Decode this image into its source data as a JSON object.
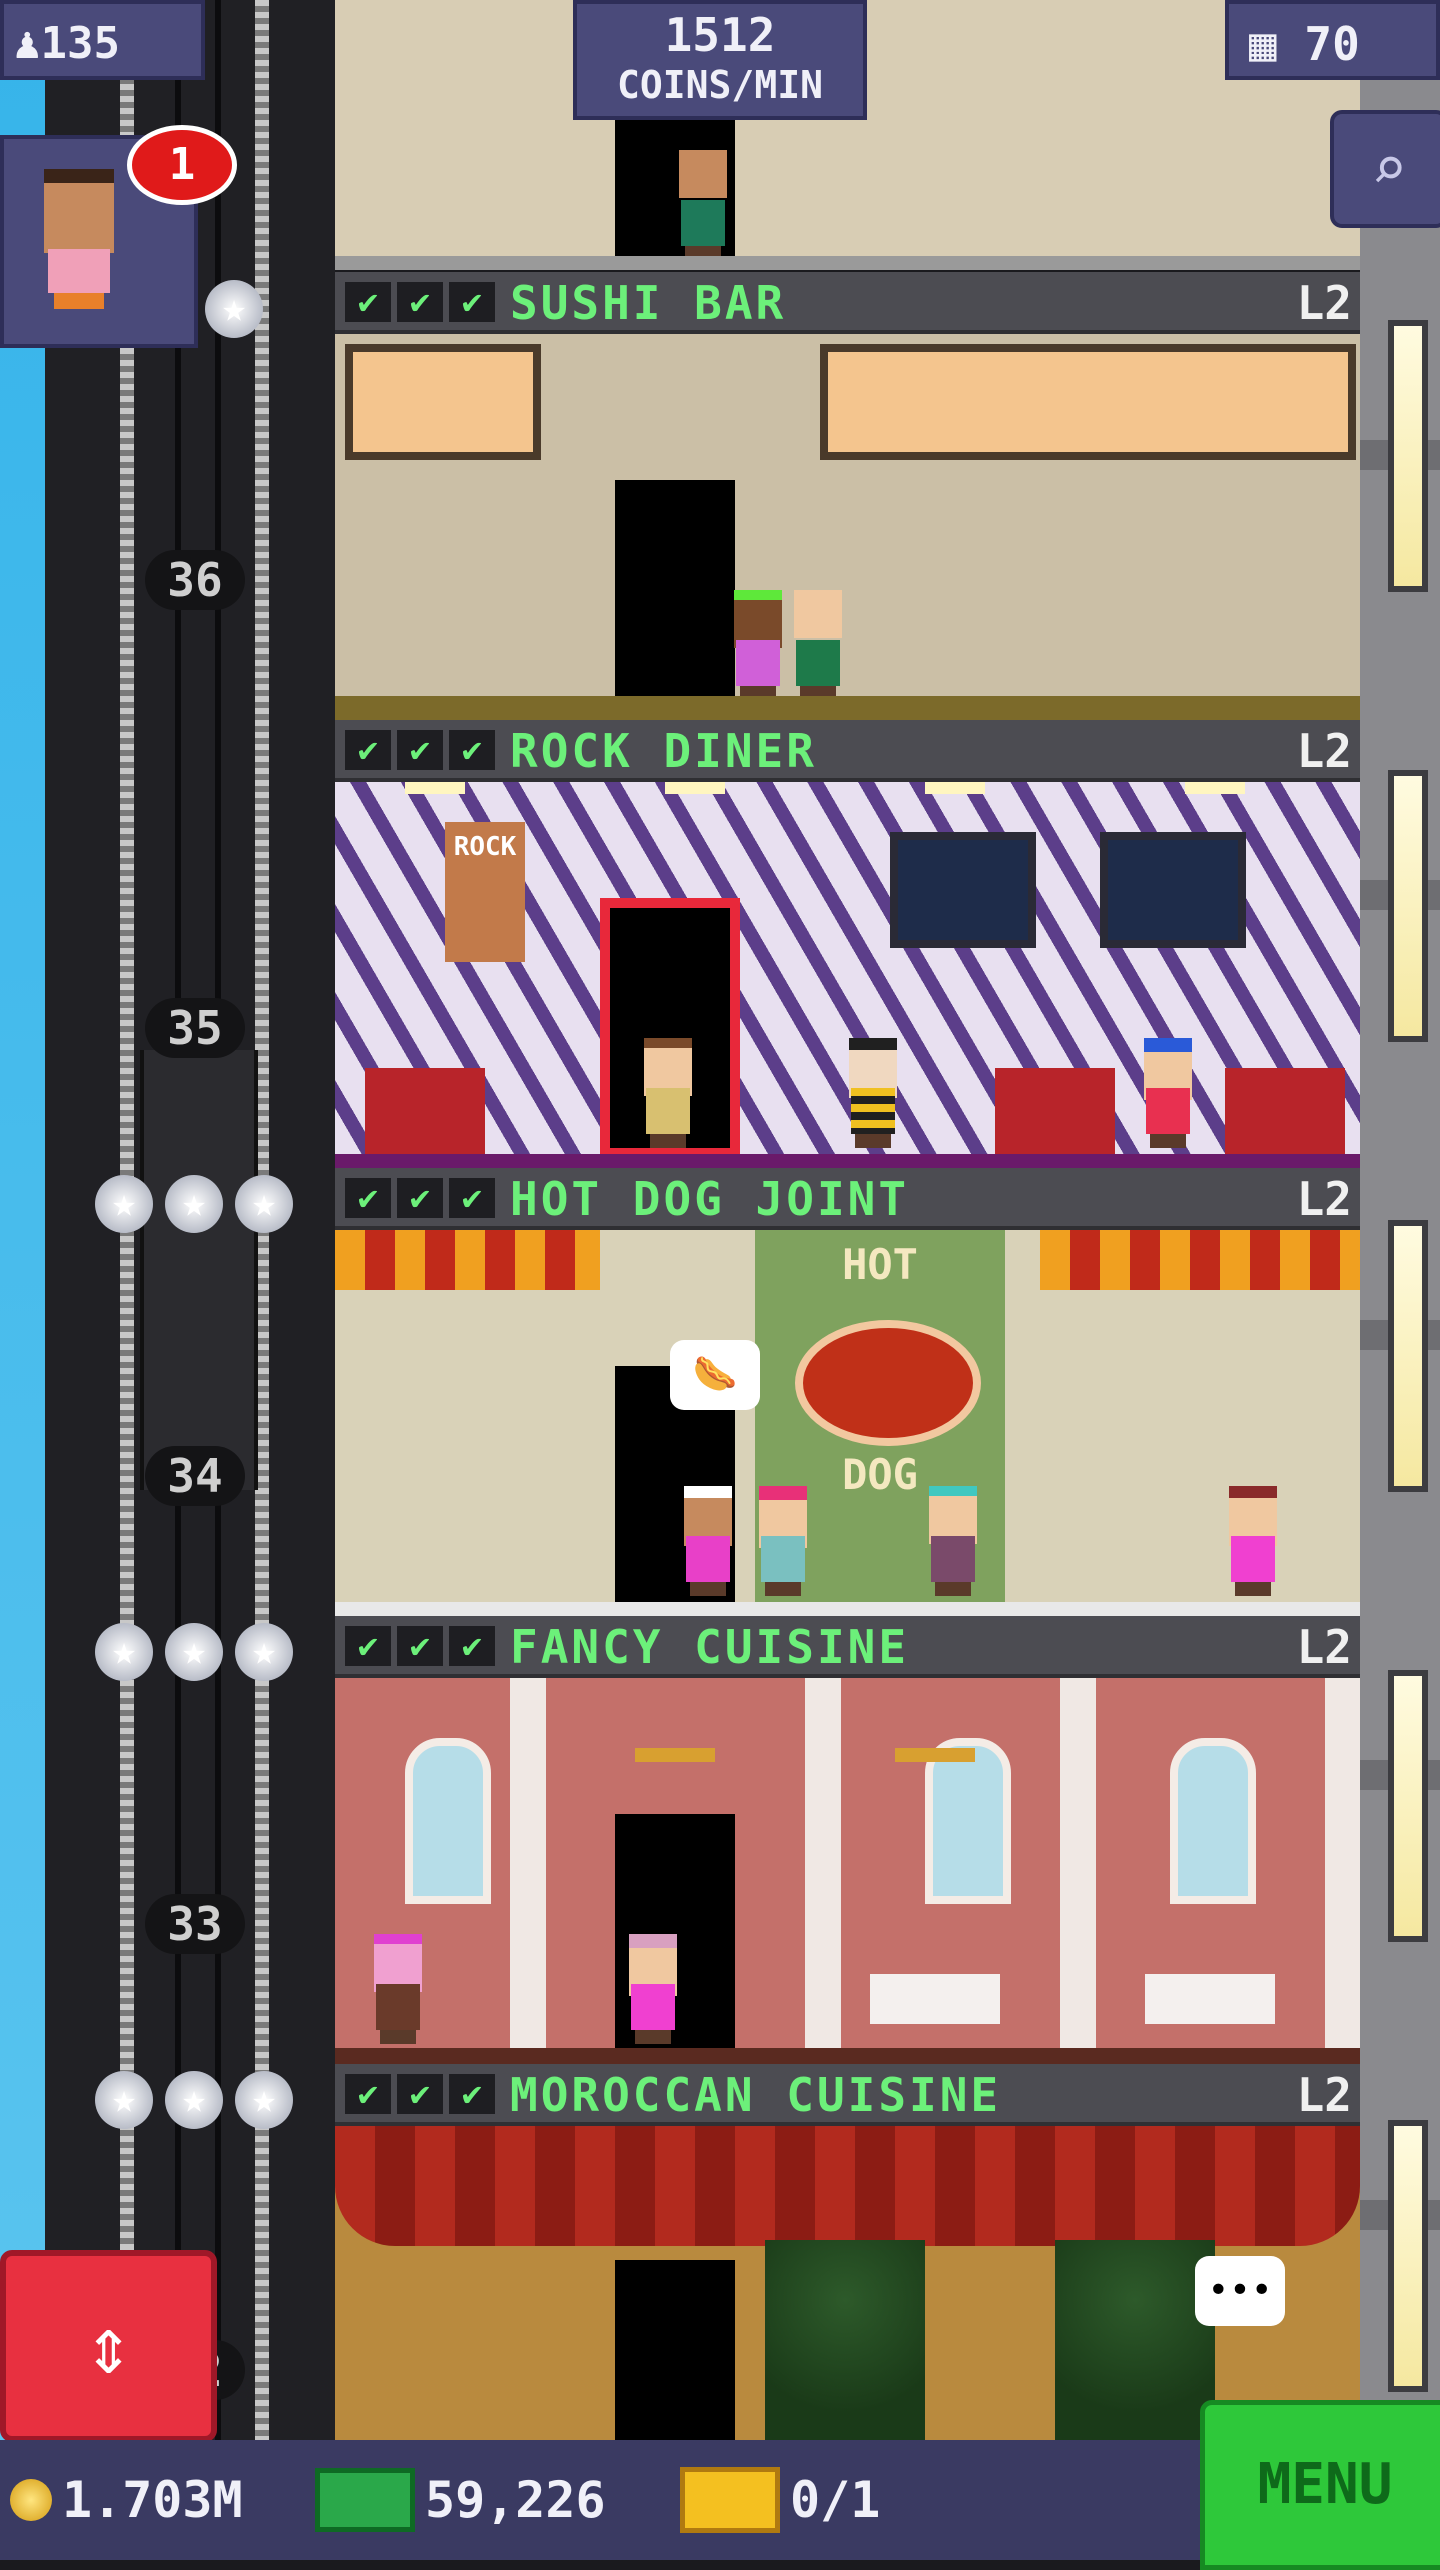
{
  "hud": {
    "population": "135",
    "coins_per_min_value": "1512",
    "coins_per_min_label": "COINS/MIN",
    "floor_count": "70",
    "visitor_notifications": "1"
  },
  "floors": [
    {
      "name": "SUSHI BAR",
      "level": "L2",
      "number": "36"
    },
    {
      "name": "ROCK DINER",
      "level": "L2",
      "number": "35"
    },
    {
      "name": "HOT DOG JOINT",
      "level": "L2",
      "number": "34"
    },
    {
      "name": "FANCY CUISINE",
      "level": "L2",
      "number": "33"
    },
    {
      "name": "MOROCCAN CUISINE",
      "level": "L2",
      "number": "32"
    }
  ],
  "checkmarks": "✔",
  "hot_dog_sign": "HOT",
  "hot_dog_sign_lower": "DOG",
  "rock_sign": "ROCK",
  "bottom_bar": {
    "coins": "1.703M",
    "bux": "59,226",
    "tickets": "0/1",
    "menu": "MENU"
  },
  "icons": {
    "population": "person-icon",
    "floors": "building-icon",
    "search": "magnifier-icon",
    "elevator": "up-down-arrow-icon",
    "coin": "coin-icon",
    "bux": "bux-icon",
    "ticket": "ticket-icon"
  },
  "colors": {
    "label_green": "#6cf07a",
    "hud_purple": "#4a4a7a",
    "menu_green": "#2ec83a",
    "elevator_red": "#e83040"
  }
}
